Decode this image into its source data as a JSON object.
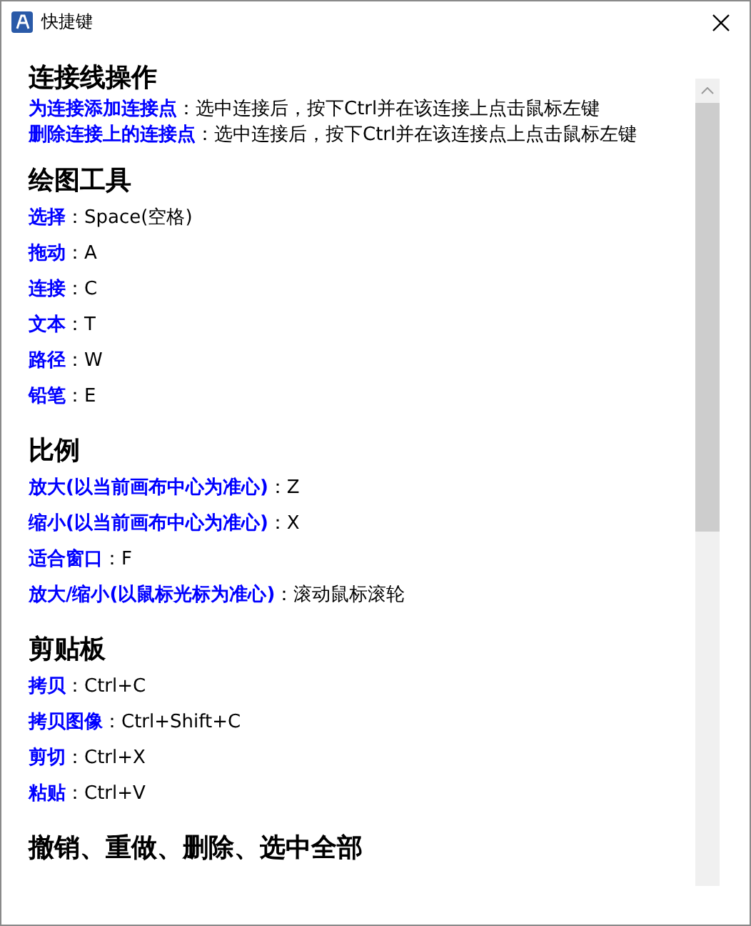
{
  "window": {
    "title": "快捷键"
  },
  "sections": [
    {
      "title": "连接线操作",
      "items": [
        {
          "key": "为连接添加连接点",
          "value": "：选中连接后，按下Ctrl并在该连接上点击鼠标左键"
        },
        {
          "key": "删除连接上的连接点",
          "value": "：选中连接后，按下Ctrl并在该连接点上点击鼠标左键"
        }
      ]
    },
    {
      "title": "绘图工具",
      "items": [
        {
          "key": "选择",
          "value": "：Space(空格)"
        },
        {
          "key": "拖动",
          "value": "：A"
        },
        {
          "key": "连接",
          "value": "：C"
        },
        {
          "key": "文本",
          "value": "：T"
        },
        {
          "key": "路径",
          "value": "：W"
        },
        {
          "key": "铅笔",
          "value": "：E"
        }
      ]
    },
    {
      "title": "比例",
      "items": [
        {
          "key": "放大(以当前画布中心为准心)",
          "value": "：Z"
        },
        {
          "key": "缩小(以当前画布中心为准心)",
          "value": "：X"
        },
        {
          "key": "适合窗口",
          "value": "：F"
        },
        {
          "key": "放大/缩小(以鼠标光标为准心)",
          "value": "：滚动鼠标滚轮"
        }
      ]
    },
    {
      "title": "剪贴板",
      "items": [
        {
          "key": "拷贝",
          "value": "：Ctrl+C"
        },
        {
          "key": "拷贝图像",
          "value": "：Ctrl+Shift+C"
        },
        {
          "key": "剪切",
          "value": "：Ctrl+X"
        },
        {
          "key": "粘贴",
          "value": "：Ctrl+V"
        }
      ]
    },
    {
      "title": "撤销、重做、删除、选中全部"
    }
  ]
}
